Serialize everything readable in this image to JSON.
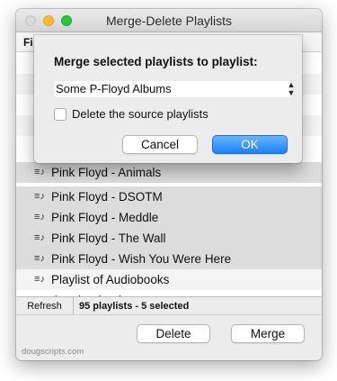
{
  "window": {
    "title": "Merge-Delete Playlists",
    "header_column": "Fi"
  },
  "rows": [
    {
      "label": "Pink Floyd - Animals",
      "selected": true
    },
    {
      "label": "Pink Floyd - DSOTM",
      "selected": true
    },
    {
      "label": "Pink Floyd - Meddle",
      "selected": true
    },
    {
      "label": "Pink Floyd - The Wall",
      "selected": true
    },
    {
      "label": "Pink Floyd - Wish You Were Here",
      "selected": true
    },
    {
      "label": "Playlist of Audiobooks",
      "selected": false
    },
    {
      "label": "Quadrophenia",
      "selected": false
    }
  ],
  "status": {
    "refresh_label": "Refresh",
    "summary": "95 playlists - 5 selected"
  },
  "buttons": {
    "delete": "Delete",
    "merge": "Merge"
  },
  "footer": {
    "credit": "dougscripts.com"
  },
  "sheet": {
    "title": "Merge selected playlists to playlist:",
    "selected_playlist": "Some P-Floyd Albums",
    "checkbox_label": "Delete the source playlists",
    "checkbox_checked": false,
    "cancel": "Cancel",
    "ok": "OK"
  },
  "colors": {
    "accent": "#1a82fb",
    "selection": "#dcdcdc"
  }
}
